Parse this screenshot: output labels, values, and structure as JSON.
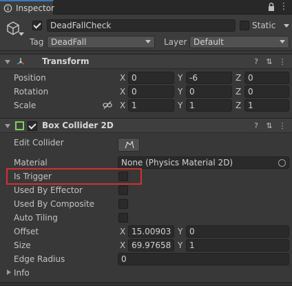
{
  "tab": {
    "title": "Inspector"
  },
  "header": {
    "object_name": "DeadFallCheck",
    "static_label": "Static",
    "tag_label": "Tag",
    "tag_value": "DeadFall",
    "layer_label": "Layer",
    "layer_value": "Default"
  },
  "transform": {
    "title": "Transform",
    "rows": [
      {
        "label": "Position",
        "x": "0",
        "y": "-6",
        "z": "0"
      },
      {
        "label": "Rotation",
        "x": "0",
        "y": "0",
        "z": "0"
      },
      {
        "label": "Scale",
        "x": "1",
        "y": "1",
        "z": "1"
      }
    ],
    "axis": {
      "x": "X",
      "y": "Y",
      "z": "Z"
    }
  },
  "box_collider": {
    "title": "Box Collider 2D",
    "edit_collider": "Edit Collider",
    "material_label": "Material",
    "material_value": "None (Physics Material 2D)",
    "is_trigger": "Is Trigger",
    "used_by_effector": "Used By Effector",
    "used_by_composite": "Used By Composite",
    "auto_tiling": "Auto Tiling",
    "offset_label": "Offset",
    "offset_x": "15.00903",
    "offset_y": "0",
    "size_label": "Size",
    "size_x": "69.97658",
    "size_y": "1",
    "edge_radius_label": "Edge Radius",
    "edge_radius_value": "0",
    "info_label": "Info"
  },
  "colors": {
    "accent": "#3a79bb",
    "highlight": "#d4312d",
    "collider_icon": "#7cd35b"
  }
}
